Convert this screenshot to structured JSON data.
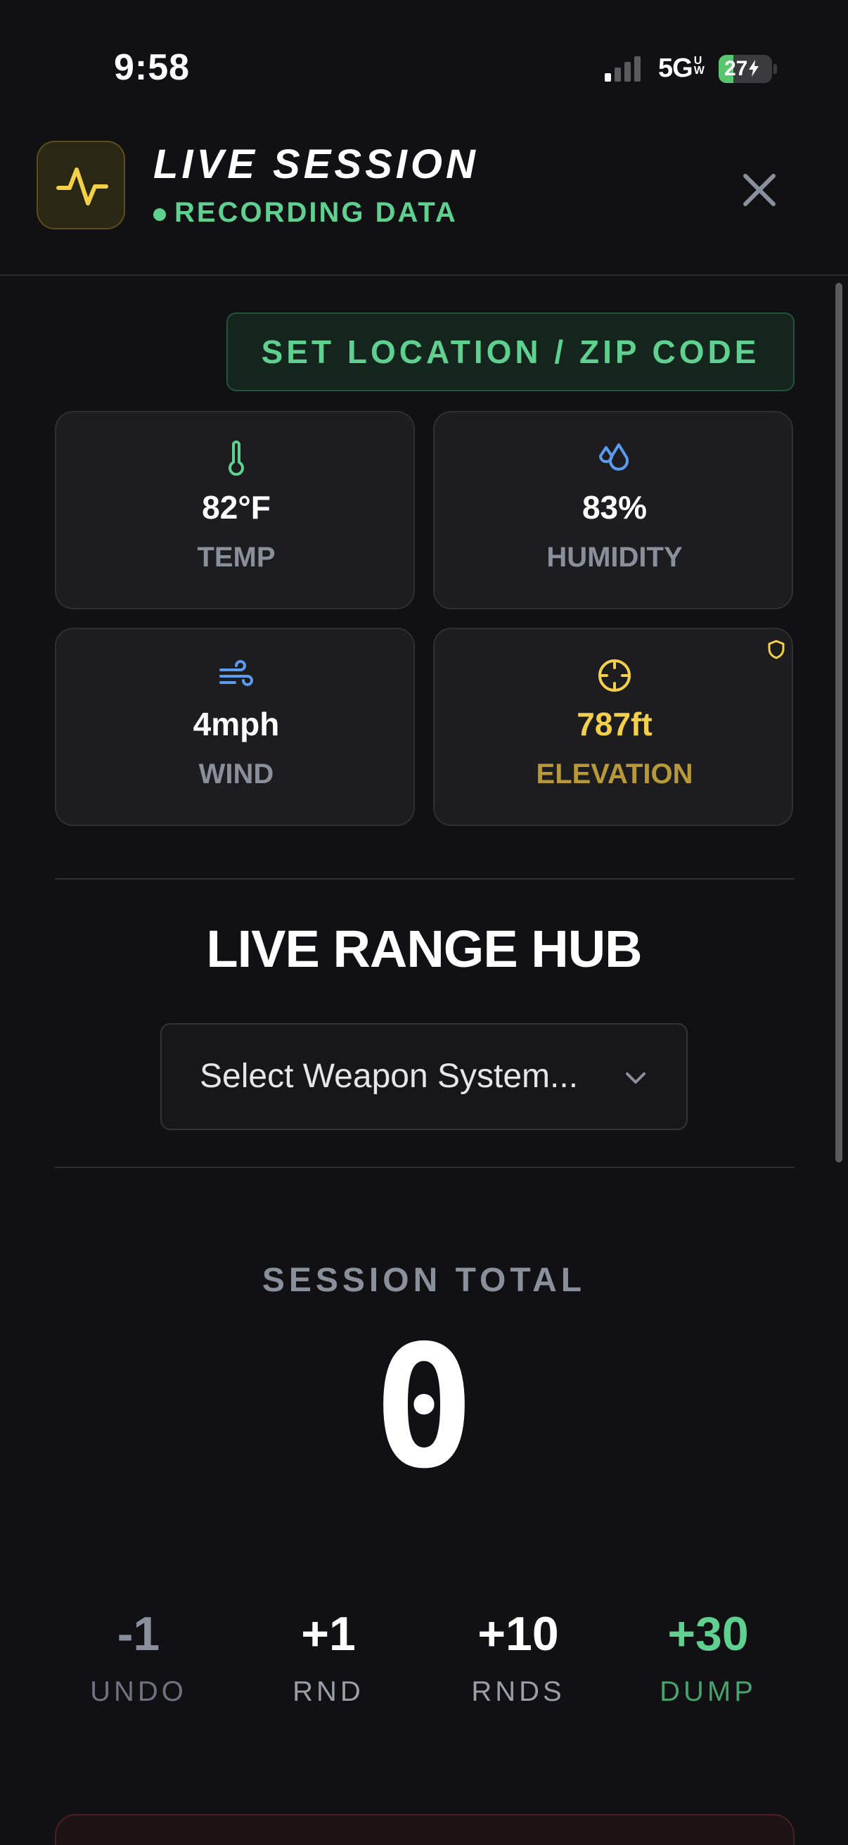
{
  "status_bar": {
    "time": "9:58",
    "network": "5G",
    "network_suffix": "UW",
    "battery_level": "27",
    "battery_percent": 27,
    "charging": true
  },
  "header": {
    "title": "LIVE SESSION",
    "subtitle": "RECORDING DATA",
    "icon": "activity-pulse-icon",
    "close_icon": "close-icon"
  },
  "location_button": {
    "label": "SET LOCATION / ZIP CODE"
  },
  "weather": [
    {
      "id": "temp",
      "icon": "thermometer-icon",
      "value": "82°F",
      "label": "TEMP",
      "icon_color": "#5fd08f"
    },
    {
      "id": "humidity",
      "icon": "droplets-icon",
      "value": "83%",
      "label": "HUMIDITY",
      "icon_color": "#5b9bf0"
    },
    {
      "id": "wind",
      "icon": "wind-icon",
      "value": "4mph",
      "label": "WIND",
      "icon_color": "#5b9bf0"
    },
    {
      "id": "elevation",
      "icon": "crosshair-icon",
      "value": "787ft",
      "label": "ELEVATION",
      "icon_color": "#f3cf4a",
      "badge": "shield-icon"
    }
  ],
  "hub": {
    "title": "LIVE RANGE HUB",
    "weapon_select_placeholder": "Select Weapon System..."
  },
  "session": {
    "total_label": "SESSION TOTAL",
    "total_value": "0"
  },
  "counters": [
    {
      "id": "undo",
      "value": "-1",
      "label": "UNDO"
    },
    {
      "id": "rnd",
      "value": "+1",
      "label": "RND"
    },
    {
      "id": "rnds",
      "value": "+10",
      "label": "RNDS"
    },
    {
      "id": "dump",
      "value": "+30",
      "label": "DUMP"
    }
  ],
  "colors": {
    "background": "#111113",
    "accent_green": "#5fd08f",
    "accent_yellow": "#f3cf4a",
    "accent_blue": "#5b9bf0",
    "muted_text": "#8a8f9c"
  }
}
